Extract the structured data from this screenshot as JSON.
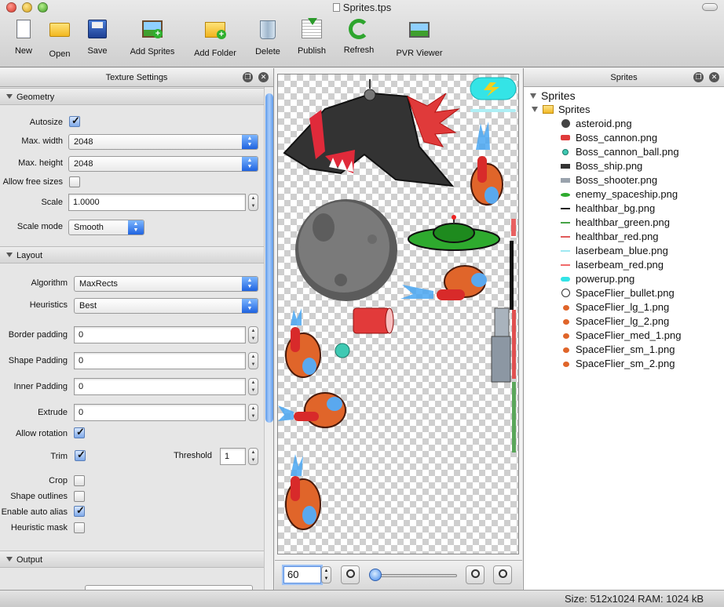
{
  "window": {
    "title": "Sprites.tps"
  },
  "toolbar": {
    "new": "New",
    "open": "Open",
    "save": "Save",
    "add_sprites": "Add Sprites",
    "add_folder": "Add Folder",
    "delete": "Delete",
    "publish": "Publish",
    "refresh": "Refresh",
    "pvr_viewer": "PVR Viewer"
  },
  "left_panel": {
    "title": "Texture Settings",
    "geometry": {
      "header": "Geometry",
      "autosize_label": "Autosize",
      "autosize": true,
      "max_width_label": "Max. width",
      "max_width": "2048",
      "max_height_label": "Max. height",
      "max_height": "2048",
      "allow_free_sizes_label": "Allow free sizes",
      "allow_free_sizes": false,
      "scale_label": "Scale",
      "scale": "1.0000",
      "scale_mode_label": "Scale mode",
      "scale_mode": "Smooth"
    },
    "layout": {
      "header": "Layout",
      "algorithm_label": "Algorithm",
      "algorithm": "MaxRects",
      "heuristics_label": "Heuristics",
      "heuristics": "Best",
      "border_padding_label": "Border padding",
      "border_padding": "0",
      "shape_padding_label": "Shape Padding",
      "shape_padding": "0",
      "inner_padding_label": "Inner Padding",
      "inner_padding": "0",
      "extrude_label": "Extrude",
      "extrude": "0",
      "allow_rotation_label": "Allow rotation",
      "allow_rotation": true,
      "trim_label": "Trim",
      "trim": true,
      "threshold_label": "Threshold",
      "threshold": "1",
      "crop_label": "Crop",
      "crop": false,
      "shape_outlines_label": "Shape outlines",
      "shape_outlines": false,
      "auto_alias_label": "Enable auto alias",
      "auto_alias": true,
      "heuristic_mask_label": "Heuristic mask",
      "heuristic_mask": false
    },
    "output": {
      "header": "Output"
    }
  },
  "canvas": {
    "zoom": "60",
    "zoom_slider_fraction": 0.0
  },
  "right_panel": {
    "title": "Sprites",
    "root": "Sprites",
    "folder": "Sprites",
    "files": [
      {
        "name": "asteroid.png",
        "icon": "asteroid-icon",
        "color": "#444444"
      },
      {
        "name": "Boss_cannon.png",
        "icon": "cannon-icon",
        "color": "#e03a3a"
      },
      {
        "name": "Boss_cannon_ball.png",
        "icon": "cannonball-icon",
        "color": "#3fc9b3"
      },
      {
        "name": "Boss_ship.png",
        "icon": "ship-icon",
        "color": "#333333"
      },
      {
        "name": "Boss_shooter.png",
        "icon": "shooter-icon",
        "color": "#9aa3ad"
      },
      {
        "name": "enemy_spaceship.png",
        "icon": "spaceship-icon",
        "color": "#2eaa2e"
      },
      {
        "name": "healthbar_bg.png",
        "icon": "bar-icon",
        "color": "#222222"
      },
      {
        "name": "healthbar_green.png",
        "icon": "bar-icon",
        "color": "#46a346"
      },
      {
        "name": "healthbar_red.png",
        "icon": "bar-icon",
        "color": "#e05a5a"
      },
      {
        "name": "laserbeam_blue.png",
        "icon": "laser-icon",
        "color": "#9fe9f2"
      },
      {
        "name": "laserbeam_red.png",
        "icon": "laser-icon",
        "color": "#f06a6a"
      },
      {
        "name": "powerup.png",
        "icon": "powerup-icon",
        "color": "#33e3e6"
      },
      {
        "name": "SpaceFlier_bullet.png",
        "icon": "bullet-icon",
        "color": "#ffffff"
      },
      {
        "name": "SpaceFlier_lg_1.png",
        "icon": "flier-icon",
        "color": "#e0652a"
      },
      {
        "name": "SpaceFlier_lg_2.png",
        "icon": "flier-icon",
        "color": "#e0652a"
      },
      {
        "name": "SpaceFlier_med_1.png",
        "icon": "flier-icon",
        "color": "#e0652a"
      },
      {
        "name": "SpaceFlier_sm_1.png",
        "icon": "flier-icon",
        "color": "#e0652a"
      },
      {
        "name": "SpaceFlier_sm_2.png",
        "icon": "flier-icon",
        "color": "#e0652a"
      }
    ]
  },
  "status": {
    "text": "Size: 512x1024 RAM: 1024 kB"
  }
}
